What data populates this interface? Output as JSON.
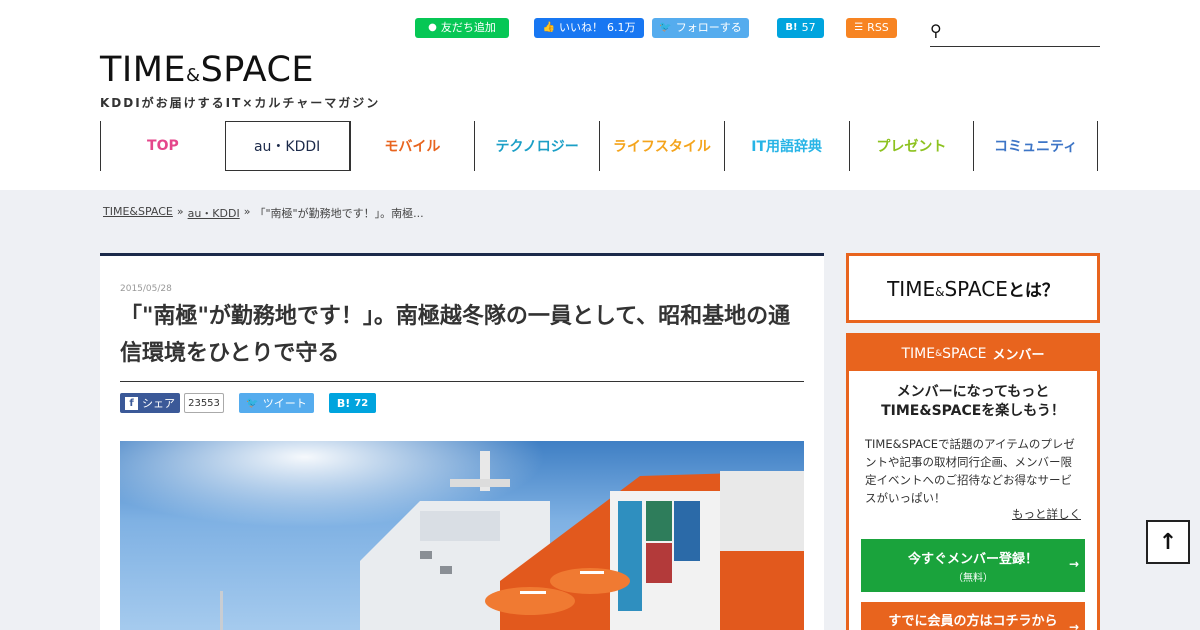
{
  "header": {
    "line_label": "友だち追加",
    "fb_like_label": "いいね！",
    "fb_like_count": "6.1万",
    "twitter_follow_label": "フォローする",
    "hatena_label": "B!",
    "hatena_count": "57",
    "rss_label": "RSS",
    "search_placeholder": ""
  },
  "logo": {
    "main_a": "TIME",
    "amp": "&",
    "main_b": "SPACE",
    "tagline": "KDDIがお届けするIT×カルチャーマガジン"
  },
  "nav": {
    "items": [
      {
        "label": "TOP",
        "color": "#e5468b"
      },
      {
        "label": "au・KDDI",
        "color": "#1c2a4a"
      },
      {
        "label": "モバイル",
        "color": "#e8641e"
      },
      {
        "label": "テクノロジー",
        "color": "#1b9fc6"
      },
      {
        "label": "ライフスタイル",
        "color": "#f4a41c"
      },
      {
        "label": "IT用語辞典",
        "color": "#27b4e6"
      },
      {
        "label": "プレゼント",
        "color": "#8dc21f"
      },
      {
        "label": "コミュニティ",
        "color": "#3d75c6"
      }
    ]
  },
  "breadcrumb": {
    "home": "TIME&SPACE",
    "sep1": "»",
    "category": "au・KDDI",
    "sep2": "»",
    "current": "「\"南極\"が勤務地です！」。南極..."
  },
  "article": {
    "date": "2015/05/28",
    "title": "「\"南極\"が勤務地です！」。南極越冬隊の一員として、昭和基地の通信環境をひとりで守る",
    "share_fb_label": "シェア",
    "share_fb_count": "23553",
    "share_tw_label": "ツイート",
    "share_hatena_label": "B!",
    "share_hatena_count": "72",
    "photo_label": "Image: Antarctic icebreaker ship"
  },
  "sidebar": {
    "about_title": "TIME&SPACEとは？",
    "about_a": "TIME",
    "about_amp": "&",
    "about_b": "SPACE",
    "about_suffix": "とは？",
    "member_head_a": "TIME",
    "member_head_amp": "&",
    "member_head_b": "SPACE",
    "member_head_suffix": "メンバー",
    "member_lead_1": "メンバーになってもっと",
    "member_lead_2": "TIME&SPACEを楽しもう！",
    "member_desc": "TIME&SPACEで話題のアイテムのプレゼントや記事の取材同行企画、メンバー限定イベントへのご招待などお得なサービスがいっぱい！",
    "more_label": "もっと詳しく",
    "register_label": "今すぐメンバー登録！",
    "register_sub": "（無料）",
    "login_label": "すでに会員の方はコチラから"
  },
  "colors": {
    "line": "#06c755",
    "facebook": "#1877f2",
    "twitter": "#55acee",
    "hatena": "#00a4de",
    "rss": "#f78422",
    "accent_orange": "#e8641e",
    "register_green": "#1aa33c",
    "navy": "#1c2a4a"
  },
  "icons": {
    "search": "search-icon",
    "to_top": "arrow-up-icon"
  }
}
